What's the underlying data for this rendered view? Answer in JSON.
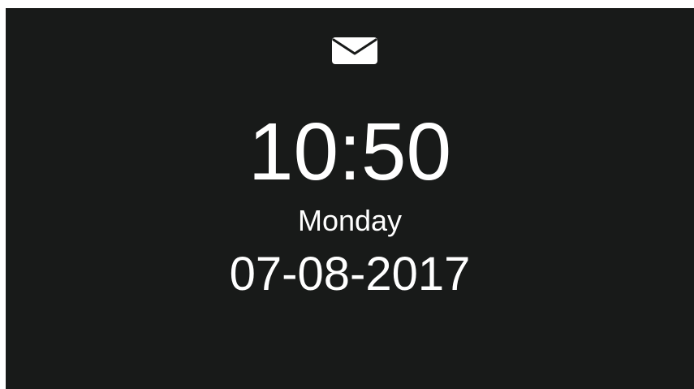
{
  "colors": {
    "background": "#181a19",
    "text": "#ffffff"
  },
  "notification": {
    "icon": "mail-icon"
  },
  "clock": {
    "time": "10:50",
    "day": "Monday",
    "date": "07-08-2017"
  }
}
